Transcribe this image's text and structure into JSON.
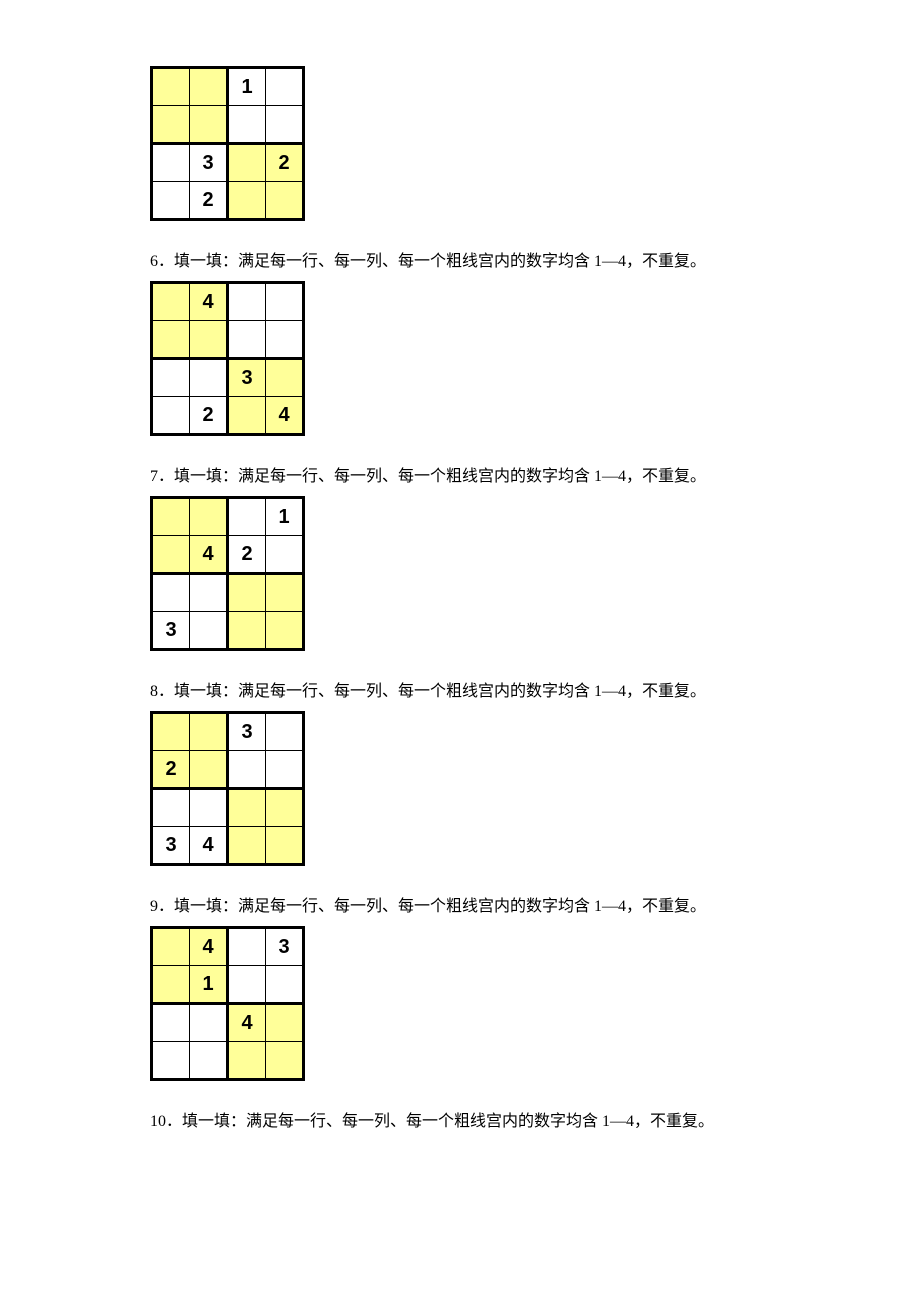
{
  "instructions": {
    "p6": "6．填一填：满足每一行、每一列、每一个粗线宫内的数字均含 1—4，不重复。",
    "p7": "7．填一填：满足每一行、每一列、每一个粗线宫内的数字均含 1—4，不重复。",
    "p8": "8．填一填：满足每一行、每一列、每一个粗线宫内的数字均含 1—4，不重复。",
    "p9": "9．填一填：满足每一行、每一列、每一个粗线宫内的数字均含 1—4，不重复。",
    "p10": "10．填一填：满足每一行、每一列、每一个粗线宫内的数字均含 1—4，不重复。"
  },
  "puzzles": {
    "p5": {
      "cells": [
        [
          {
            "v": ""
          },
          {
            "v": ""
          },
          {
            "v": "1"
          },
          {
            "v": ""
          }
        ],
        [
          {
            "v": ""
          },
          {
            "v": ""
          },
          {
            "v": ""
          },
          {
            "v": ""
          }
        ],
        [
          {
            "v": ""
          },
          {
            "v": "3"
          },
          {
            "v": ""
          },
          {
            "v": "2"
          }
        ],
        [
          {
            "v": ""
          },
          {
            "v": "2"
          },
          {
            "v": ""
          },
          {
            "v": ""
          }
        ]
      ]
    },
    "p6": {
      "cells": [
        [
          {
            "v": ""
          },
          {
            "v": "4"
          },
          {
            "v": ""
          },
          {
            "v": ""
          }
        ],
        [
          {
            "v": ""
          },
          {
            "v": ""
          },
          {
            "v": ""
          },
          {
            "v": ""
          }
        ],
        [
          {
            "v": ""
          },
          {
            "v": ""
          },
          {
            "v": "3"
          },
          {
            "v": ""
          }
        ],
        [
          {
            "v": ""
          },
          {
            "v": "2"
          },
          {
            "v": ""
          },
          {
            "v": "4"
          }
        ]
      ]
    },
    "p7": {
      "cells": [
        [
          {
            "v": ""
          },
          {
            "v": ""
          },
          {
            "v": ""
          },
          {
            "v": "1"
          }
        ],
        [
          {
            "v": ""
          },
          {
            "v": "4"
          },
          {
            "v": "2"
          },
          {
            "v": ""
          }
        ],
        [
          {
            "v": ""
          },
          {
            "v": ""
          },
          {
            "v": ""
          },
          {
            "v": ""
          }
        ],
        [
          {
            "v": "3"
          },
          {
            "v": ""
          },
          {
            "v": ""
          },
          {
            "v": ""
          }
        ]
      ]
    },
    "p8": {
      "cells": [
        [
          {
            "v": ""
          },
          {
            "v": ""
          },
          {
            "v": "3"
          },
          {
            "v": ""
          }
        ],
        [
          {
            "v": "2"
          },
          {
            "v": ""
          },
          {
            "v": ""
          },
          {
            "v": ""
          }
        ],
        [
          {
            "v": ""
          },
          {
            "v": ""
          },
          {
            "v": ""
          },
          {
            "v": ""
          }
        ],
        [
          {
            "v": "3"
          },
          {
            "v": "4"
          },
          {
            "v": ""
          },
          {
            "v": ""
          }
        ]
      ]
    },
    "p9": {
      "cells": [
        [
          {
            "v": ""
          },
          {
            "v": "4"
          },
          {
            "v": ""
          },
          {
            "v": "3"
          }
        ],
        [
          {
            "v": ""
          },
          {
            "v": "1"
          },
          {
            "v": ""
          },
          {
            "v": ""
          }
        ],
        [
          {
            "v": ""
          },
          {
            "v": ""
          },
          {
            "v": "4"
          },
          {
            "v": ""
          }
        ],
        [
          {
            "v": ""
          },
          {
            "v": ""
          },
          {
            "v": ""
          },
          {
            "v": ""
          }
        ]
      ]
    }
  }
}
